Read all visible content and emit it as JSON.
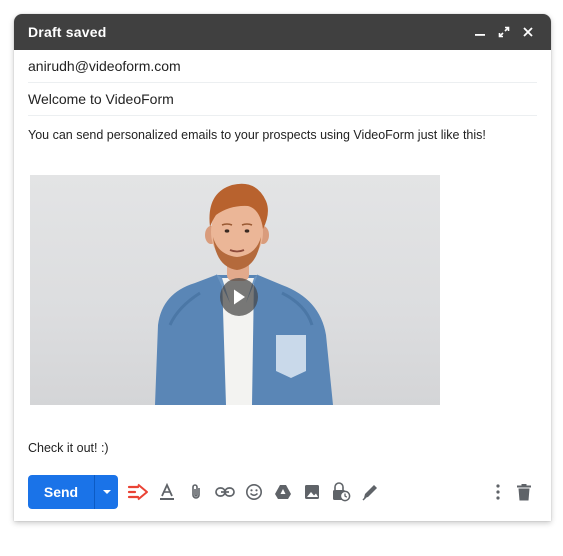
{
  "window": {
    "title": "Draft saved",
    "minimize_icon": "minimize-icon",
    "expand_icon": "expand-icon",
    "close_icon": "close-icon"
  },
  "recipients": {
    "to_value": "anirudh@videoform.com"
  },
  "subject": {
    "value": "Welcome to VideoForm"
  },
  "body": {
    "intro": "You can send personalized emails to your prospects using VideoForm just like this!",
    "video_thumbnail": "person-in-denim-shirt",
    "outro": "Check it out! :)"
  },
  "toolbar": {
    "send_label": "Send",
    "icons": [
      "videoform-icon",
      "format-text-icon",
      "attach-icon",
      "link-icon",
      "emoji-icon",
      "drive-icon",
      "photo-icon",
      "confidential-icon",
      "signature-icon",
      "more-options-icon",
      "delete-icon"
    ]
  },
  "colors": {
    "titlebar": "#404040",
    "send_button": "#1a73e8",
    "videoform_accent": "#ea4335"
  }
}
